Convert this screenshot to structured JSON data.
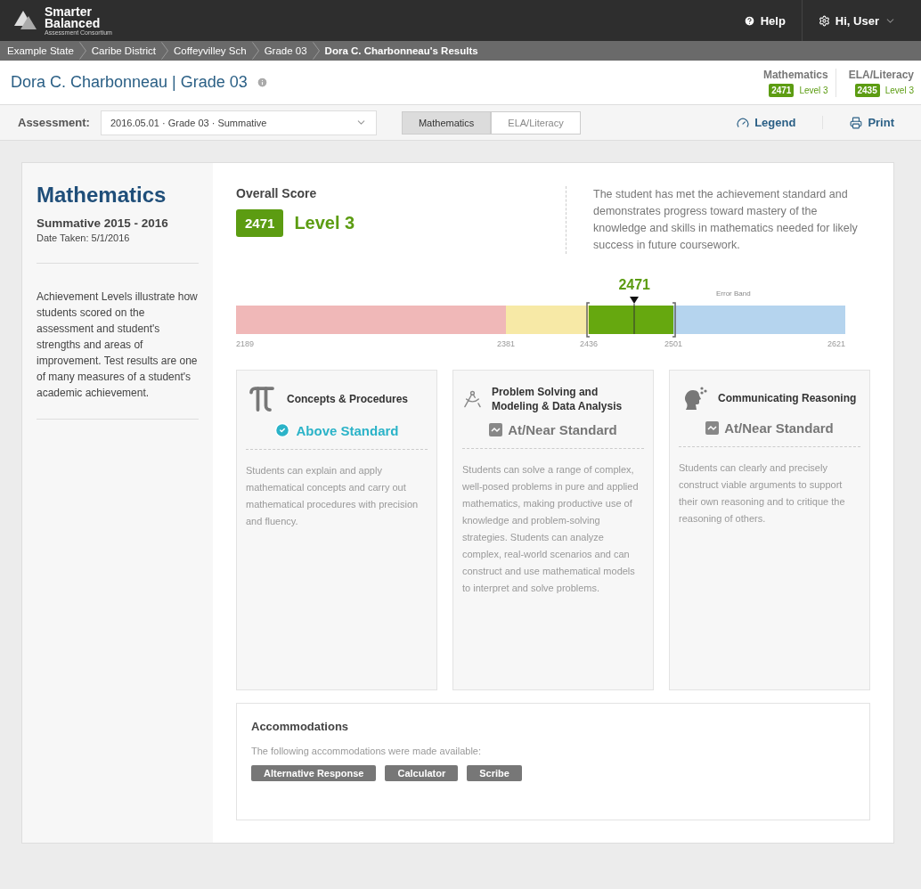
{
  "header": {
    "logo_title": "Smarter Balanced",
    "logo_subtitle": "Assessment Consortium",
    "help": "Help",
    "user": "Hi, User"
  },
  "breadcrumbs": [
    {
      "label": "Example State",
      "current": false
    },
    {
      "label": "Caribe District",
      "current": false
    },
    {
      "label": "Coffeyvilley Sch",
      "current": false
    },
    {
      "label": "Grade 03",
      "current": false
    },
    {
      "label": "Dora C. Charbonneau's Results",
      "current": true
    }
  ],
  "student": {
    "title": "Dora C. Charbonneau | Grade 03",
    "summaries": [
      {
        "subject": "Mathematics",
        "score": "2471",
        "level": "Level 3"
      },
      {
        "subject": "ELA/Literacy",
        "score": "2435",
        "level": "Level 3"
      }
    ]
  },
  "toolbar": {
    "label": "Assessment:",
    "assessment": "2016.05.01 · Grade 03 · Summative",
    "tabs": [
      {
        "label": "Mathematics",
        "selected": true
      },
      {
        "label": "ELA/Literacy",
        "selected": false
      }
    ],
    "legend": "Legend",
    "print": "Print"
  },
  "sidebar": {
    "subject": "Mathematics",
    "test": "Summative 2015 - 2016",
    "date_label": "Date Taken:",
    "date": "5/1/2016",
    "description": "Achievement Levels illustrate how students scored on the assessment and student's strengths and areas of improvement. Test results are one of many measures of a student's academic achievement."
  },
  "overall": {
    "heading": "Overall Score",
    "score": "2471",
    "level": "Level 3",
    "description": "The student has met the achievement standard and demonstrates progress toward mastery of the knowledge and skills in mathematics needed for likely success in future coursework.",
    "marker": "2471",
    "error_band": "Error Band",
    "segments": [
      {
        "color": "#f0b8b8"
      },
      {
        "color": "#f7e9a6"
      },
      {
        "color": "#66a80f"
      },
      {
        "color": "#b5d4ee"
      }
    ],
    "ticks": [
      "2189",
      "2381",
      "2436",
      "2501",
      "2621"
    ]
  },
  "claims": [
    {
      "title": "Concepts & Procedures",
      "kind": "above",
      "status": "Above Standard",
      "description": "Students can explain and apply mathematical concepts and carry out mathematical procedures with precision and fluency."
    },
    {
      "title": "Problem Solving and Modeling & Data Analysis",
      "kind": "near",
      "status": "At/Near Standard",
      "description": "Students can solve a range of complex, well-posed problems in pure and applied mathematics, making productive use of knowledge and problem-solving strategies. Students can analyze complex, real-world scenarios and can construct and use mathematical models to interpret and solve problems."
    },
    {
      "title": "Communicating Reasoning",
      "kind": "near",
      "status": "At/Near Standard",
      "description": "Students can clearly and precisely construct viable arguments to support their own reasoning and to critique the reasoning of others."
    }
  ],
  "accommodations": {
    "heading": "Accommodations",
    "intro": "The following accommodations were made available:",
    "tags": [
      "Alternative Response",
      "Calculator",
      "Scribe"
    ]
  }
}
